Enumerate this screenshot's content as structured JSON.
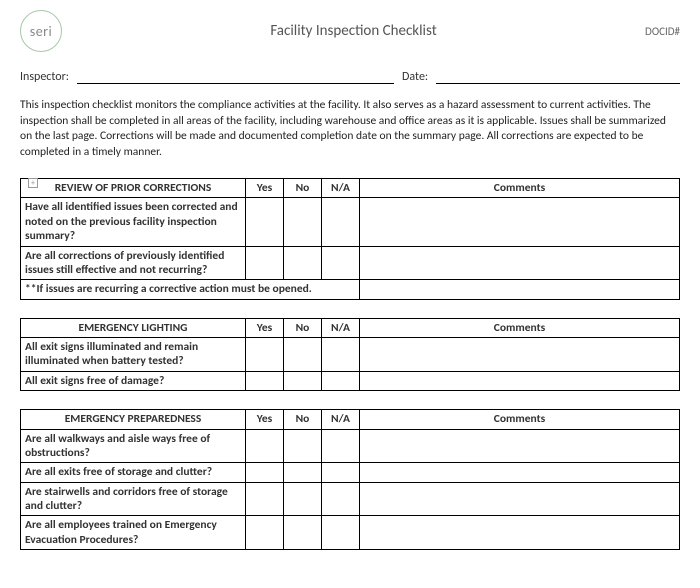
{
  "header": {
    "logo_text": "seri",
    "title": "Facility Inspection Checklist",
    "docid_label": "DOCID#"
  },
  "fields": {
    "inspector_label": "Inspector:",
    "date_label": "Date:"
  },
  "intro": "This inspection checklist monitors the compliance activities at the facility.  It also serves as a hazard assessment to current activities.  The inspection shall be completed in all areas of the facility, including warehouse and office areas as it is applicable.  Issues shall be summarized on the last page.  Corrections will be made and documented completion date on the summary page.   All corrections are expected to be completed in a timely manner.",
  "columns": {
    "yes": "Yes",
    "no": "No",
    "na": "N/A",
    "comments": "Comments"
  },
  "sections": [
    {
      "title": "REVIEW OF PRIOR CORRECTIONS",
      "rows": [
        {
          "question": "Have all identified issues been corrected and noted on the previous facility inspection summary?"
        },
        {
          "question": "Are all corrections of previously identified issues still effective and not recurring?"
        }
      ],
      "note": "**If issues are recurring a corrective action must be opened."
    },
    {
      "title": "EMERGENCY LIGHTING",
      "rows": [
        {
          "question": "All exit signs illuminated and remain illuminated when battery tested?"
        },
        {
          "question": "All exit signs free of damage?"
        }
      ]
    },
    {
      "title": "EMERGENCY PREPAREDNESS",
      "rows": [
        {
          "question": "Are all walkways and aisle ways free of obstructions?"
        },
        {
          "question": "Are all exits free of storage and clutter?"
        },
        {
          "question": "Are stairwells and corridors free of storage and clutter?"
        },
        {
          "question": "Are all employees trained on Emergency Evacuation Procedures?"
        }
      ]
    }
  ]
}
